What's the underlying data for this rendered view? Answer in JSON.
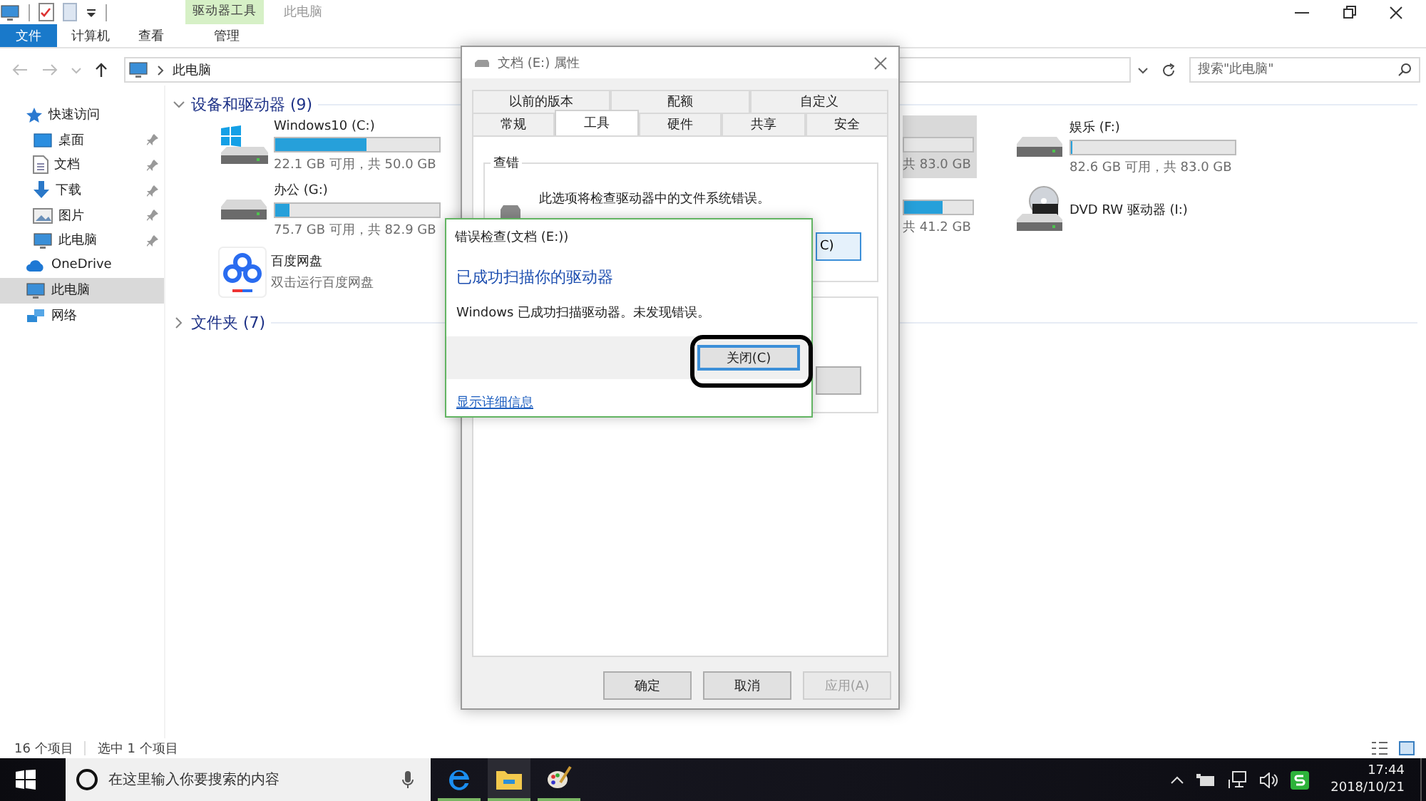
{
  "title_bar": {
    "context_label": "驱动器工具",
    "title": "此电脑"
  },
  "ribbon_tabs": [
    {
      "label": "文件",
      "kind": "file"
    },
    {
      "label": "计算机",
      "kind": "tab"
    },
    {
      "label": "查看",
      "kind": "tab"
    },
    {
      "label": "管理",
      "kind": "context"
    }
  ],
  "address": {
    "path": "此电脑",
    "search_placeholder": "搜索\"此电脑\""
  },
  "sidebar": [
    {
      "label": "快速访问",
      "kind": "star",
      "selected": false,
      "children": [
        {
          "label": "桌面",
          "kind": "desktop",
          "pinned": true,
          "selected": false
        },
        {
          "label": "文档",
          "kind": "document",
          "pinned": true,
          "selected": false
        },
        {
          "label": "下载",
          "kind": "download",
          "pinned": true,
          "selected": false
        },
        {
          "label": "图片",
          "kind": "picture",
          "pinned": true,
          "selected": false
        },
        {
          "label": "此电脑",
          "kind": "computer",
          "pinned": true,
          "selected": false
        }
      ]
    },
    {
      "label": "OneDrive",
      "kind": "cloud",
      "selected": false
    },
    {
      "label": "此电脑",
      "kind": "computer",
      "selected": true
    },
    {
      "label": "网络",
      "kind": "network",
      "selected": false
    }
  ],
  "sections": [
    {
      "title": "设备和驱动器 (9)",
      "expanded": true,
      "items": [
        {
          "name": "Windows10 (C:)",
          "kind": "windows-drive",
          "level": 0.56,
          "reading": "22.1 GB 可用，共 50.0 GB",
          "selected": false
        },
        {
          "kind": "covered-drive",
          "level": 0,
          "reading": "共 83.0 GB",
          "selected": true
        },
        {
          "name": "娱乐 (F:)",
          "kind": "drive",
          "level": 0.005,
          "reading": "82.6 GB 可用，共 83.0 GB",
          "selected": false
        },
        {
          "name": "办公 (G:)",
          "kind": "drive",
          "level": 0.087,
          "reading": "75.7 GB 可用，共 82.9 GB",
          "selected": false
        },
        {
          "kind": "covered-drive",
          "level": 0.56,
          "reading": "共 41.2 GB",
          "selected": false
        },
        {
          "name": "DVD RW 驱动器 (I:)",
          "kind": "dvd",
          "selected": false
        },
        {
          "name": "百度网盘",
          "kind": "app",
          "reading": "双击运行百度网盘",
          "selected": false
        }
      ]
    },
    {
      "title": "文件夹 (7)",
      "expanded": false
    }
  ],
  "status_bar": {
    "count": "16 个项目",
    "selection": "选中 1 个项目"
  },
  "properties": {
    "title": "文档 (E:) 属性",
    "tab_rows": [
      [
        {
          "label": "以前的版本",
          "selected": false
        },
        {
          "label": "配额",
          "selected": false
        },
        {
          "label": "自定义",
          "selected": false
        }
      ],
      [
        {
          "label": "常规",
          "selected": false
        },
        {
          "label": "工具",
          "selected": true
        },
        {
          "label": "硬件",
          "selected": false
        },
        {
          "label": "共享",
          "selected": false
        },
        {
          "label": "安全",
          "selected": false
        }
      ]
    ],
    "group_title": "查错",
    "group_text": "此选项将检查驱动器中的文件系统错误。",
    "check_button": "C)",
    "buttons": [
      {
        "label": "确定",
        "disabled": false
      },
      {
        "label": "取消",
        "disabled": false
      },
      {
        "label": "应用(A)",
        "disabled": true
      }
    ]
  },
  "error_dialog": {
    "title": "错误检查(文档 (E:))",
    "heading": "已成功扫描你的驱动器",
    "message": "Windows 已成功扫描驱动器。未发现错误。",
    "button": "关闭(C)",
    "link": "显示详细信息"
  },
  "taskbar": {
    "search_placeholder": "在这里输入你要搜索的内容",
    "apps": [
      {
        "kind": "edge",
        "selected": false
      },
      {
        "kind": "explorer",
        "selected": true
      },
      {
        "kind": "paint",
        "selected": false
      }
    ],
    "time": "17:44",
    "date": "2018/10/21"
  }
}
